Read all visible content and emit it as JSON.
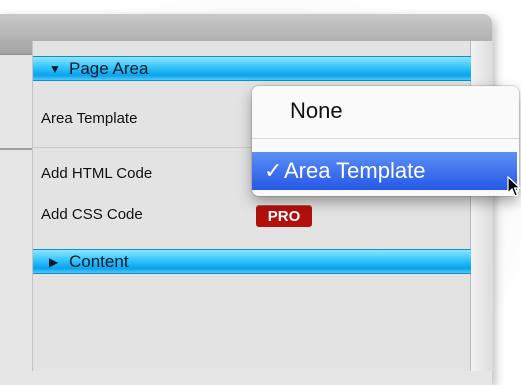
{
  "sections": [
    {
      "label": "Page Area",
      "expanded": true,
      "triangle": "▼"
    },
    {
      "label": "Content",
      "expanded": false,
      "triangle": "▶"
    }
  ],
  "rows": [
    {
      "label": "Area Template"
    },
    {
      "label": "Add HTML Code"
    },
    {
      "label": "Add CSS Code"
    }
  ],
  "pro_badge": "PRO",
  "dropdown": {
    "options": [
      {
        "label": "None",
        "selected": false
      },
      {
        "label": "Area Template",
        "selected": true
      }
    ],
    "check_mark": "✓"
  },
  "colors": {
    "section_header": "#1fb4f4",
    "menu_highlight": "#2f66eb",
    "pro_badge": "#b1100d"
  },
  "icons": {
    "expanded": "triangle-down-icon",
    "collapsed": "triangle-right-icon",
    "checkmark": "checkmark-icon",
    "cursor": "mouse-pointer-icon"
  }
}
